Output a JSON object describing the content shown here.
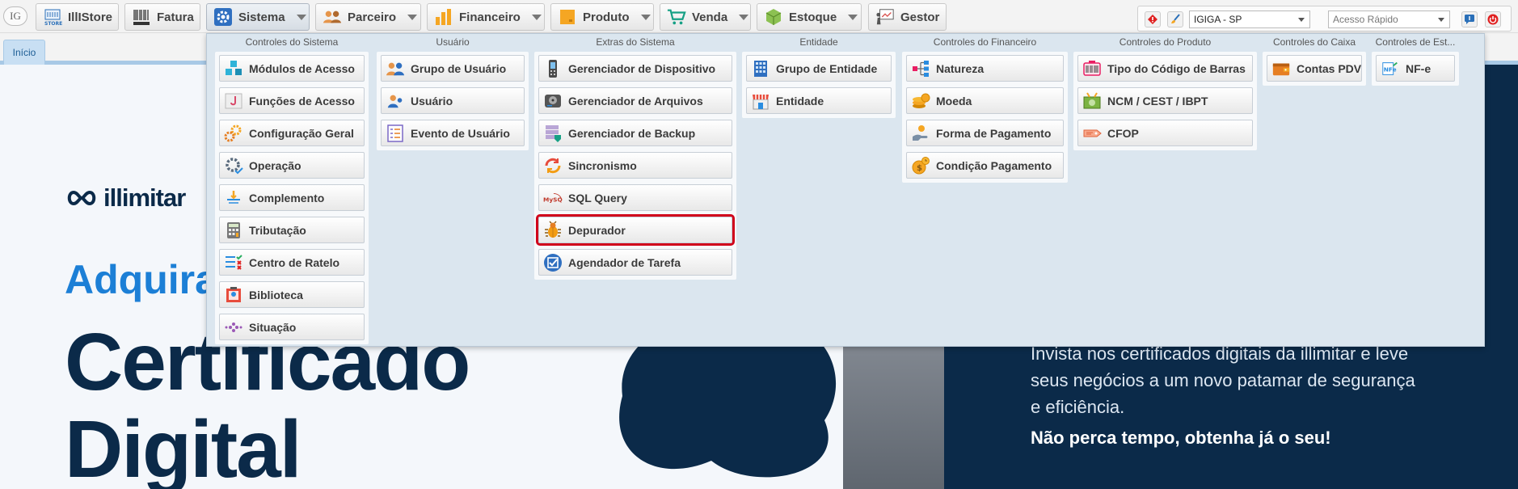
{
  "toolbar": {
    "logo": "IG",
    "buttons": [
      {
        "label": "IllIStore",
        "icon": "store-icon"
      },
      {
        "label": "Fatura",
        "icon": "barcode-boleto-icon"
      },
      {
        "label": "Sistema",
        "icon": "gear-icon"
      },
      {
        "label": "Parceiro",
        "icon": "people-icon"
      },
      {
        "label": "Financeiro",
        "icon": "bar-chart-icon"
      },
      {
        "label": "Produto",
        "icon": "box-icon"
      },
      {
        "label": "Venda",
        "icon": "cart-icon"
      },
      {
        "label": "Estoque",
        "icon": "package-icon"
      },
      {
        "label": "Gestor",
        "icon": "presentation-icon"
      }
    ],
    "company_select": "IGIGA - SP",
    "quick_access_placeholder": "Acesso Rápido"
  },
  "tabs": [
    {
      "label": "Início"
    }
  ],
  "menu": {
    "groups": [
      {
        "title": "Controles do Sistema",
        "items": [
          {
            "label": "Módulos de Acesso",
            "icon": "cubes-icon"
          },
          {
            "label": "Funções de Acesso",
            "icon": "function-icon"
          },
          {
            "label": "Configuração Geral",
            "icon": "gears-icon"
          },
          {
            "label": "Operação",
            "icon": "cog-check-icon"
          },
          {
            "label": "Complemento",
            "icon": "complement-icon"
          },
          {
            "label": "Tributação",
            "icon": "calculator-icon"
          },
          {
            "label": "Centro de Ratelo",
            "icon": "checklist-icon"
          },
          {
            "label": "Biblioteca",
            "icon": "library-icon"
          },
          {
            "label": "Situação",
            "icon": "dots-icon"
          }
        ]
      },
      {
        "title": "Usuário",
        "items": [
          {
            "label": "Grupo de Usuário",
            "icon": "user-group-icon"
          },
          {
            "label": "Usuário",
            "icon": "user-icon"
          },
          {
            "label": "Evento de Usuário",
            "icon": "event-list-icon"
          }
        ]
      },
      {
        "title": "Extras do Sistema",
        "items": [
          {
            "label": "Gerenciador de Dispositivo",
            "icon": "device-icon"
          },
          {
            "label": "Gerenciador de Arquivos",
            "icon": "hard-drive-icon"
          },
          {
            "label": "Gerenciador de Backup",
            "icon": "backup-icon"
          },
          {
            "label": "Sincronismo",
            "icon": "sync-icon"
          },
          {
            "label": "SQL Query",
            "icon": "mysql-icon"
          },
          {
            "label": "Depurador",
            "icon": "bug-icon"
          },
          {
            "label": "Agendador de Tarefa",
            "icon": "task-check-icon"
          }
        ]
      },
      {
        "title": "Entidade",
        "items": [
          {
            "label": "Grupo de Entidade",
            "icon": "building-icon"
          },
          {
            "label": "Entidade",
            "icon": "shop-icon"
          }
        ]
      },
      {
        "title": "Controles do Financeiro",
        "items": [
          {
            "label": "Natureza",
            "icon": "hierarchy-icon"
          },
          {
            "label": "Moeda",
            "icon": "coins-icon"
          },
          {
            "label": "Forma de Pagamento",
            "icon": "hand-coin-icon"
          },
          {
            "label": "Condição Pagamento",
            "icon": "coin-clock-icon"
          }
        ]
      },
      {
        "title": "Controles do Produto",
        "items": [
          {
            "label": "Tipo do Código de Barras",
            "icon": "barcode-scanner-icon"
          },
          {
            "label": "NCM / CEST / IBPT",
            "icon": "money-icon"
          },
          {
            "label": "CFOP",
            "icon": "tag-icon"
          }
        ]
      },
      {
        "title": "Controles do Caixa",
        "items": [
          {
            "label": "Contas PDV",
            "icon": "wallet-icon"
          }
        ]
      },
      {
        "title": "Controles de Est...",
        "items": [
          {
            "label": "NF-e",
            "icon": "nfe-icon"
          }
        ]
      }
    ]
  },
  "banner": {
    "brand": "illimitar",
    "headline_small": "Adquira",
    "headline_line1": "Certificado",
    "headline_line2": "Digital",
    "body_line1": "Invista nos certificados digitais da illimitar e leve",
    "body_line2": "seus negócios a um novo patamar de segurança",
    "body_line3": "e eficiência.",
    "body_strong": "Não perca tempo, obtenha já o seu!"
  }
}
